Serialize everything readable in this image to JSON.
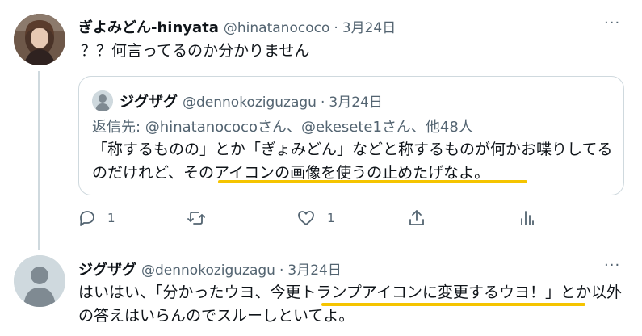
{
  "tweet1": {
    "display_name": "ぎよみどん-hinyata",
    "handle": "@hinatanococo",
    "separator": "·",
    "date": "3月24日",
    "text": "？？何言ってるのか分かりません",
    "more_label": "···"
  },
  "quote": {
    "display_name": "ジグザグ",
    "handle": "@dennokoziguzagu",
    "separator": "·",
    "date": "3月24日",
    "reply_to": "返信先: @hinatanococoさん、@ekesete1さん、他48人",
    "text": "「称するものの」とか「ぎょみどん」などと称するものが何かお喋りしてるのだけれど、そのアイコンの画像を使うの止めたげなよ。"
  },
  "actions": {
    "reply_count": "1",
    "retweet_count": "",
    "like_count": "1",
    "icons": [
      "reply-icon",
      "retweet-icon",
      "like-icon",
      "share-icon",
      "analytics-icon"
    ]
  },
  "tweet2": {
    "display_name": "ジグザグ",
    "handle": "@dennokoziguzagu",
    "separator": "·",
    "date": "3月24日",
    "text": "はいはい、「分かったウヨ、今更トランプアイコンに変更するウヨ！」とか以外の答えはいらんのでスルーしといてよ。",
    "more_label": "···"
  },
  "colors": {
    "muted": "#536471",
    "border": "#cfd9de",
    "highlight": "#f5c400"
  }
}
